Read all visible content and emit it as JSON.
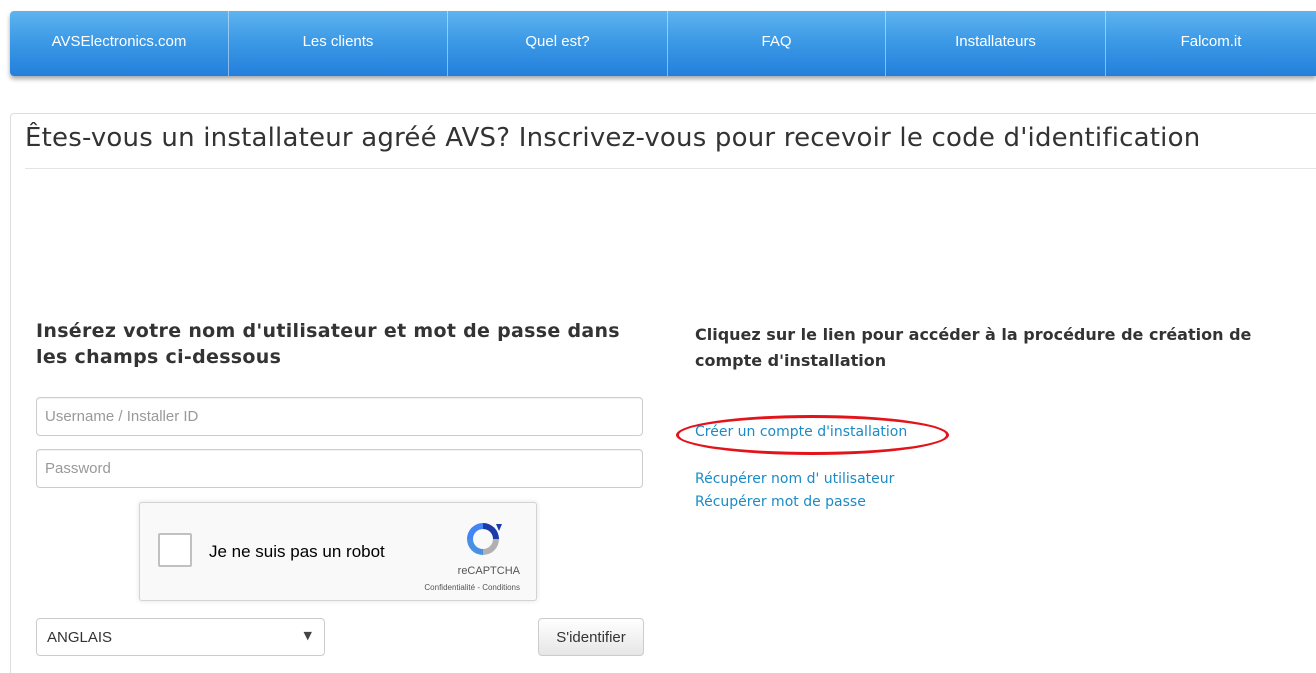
{
  "nav": {
    "items": [
      {
        "label": "AVSElectronics.com"
      },
      {
        "label": "Les clients"
      },
      {
        "label": "Quel est?"
      },
      {
        "label": "FAQ"
      },
      {
        "label": "Installateurs"
      },
      {
        "label": "Falcom.it"
      }
    ]
  },
  "page": {
    "title": "Êtes-vous un installateur agréé AVS? Inscrivez-vous pour recevoir le code d'identification"
  },
  "login": {
    "heading": "Insérez votre nom d'utilisateur et mot de passe dans les champs ci-dessous",
    "username_placeholder": "Username / Installer ID",
    "password_placeholder": "Password",
    "captcha": {
      "label": "Je ne suis pas un robot",
      "brand": "reCAPTCHA",
      "links": "Confidentialité - Conditions"
    },
    "language": {
      "selected": "ANGLAIS"
    },
    "submit_label": "S'identifier"
  },
  "account": {
    "heading": "Cliquez sur le lien pour accéder à la procédure de création de compte d'installation",
    "create_link": "Créer un compte d'installation",
    "recover_user_link": "Récupérer nom d' utilisateur",
    "recover_pass_link": "Récupérer mot de passe"
  },
  "colors": {
    "nav_top": "#5fb4f0",
    "nav_bottom": "#237fdb",
    "link": "#1a8bc6",
    "annotation_ellipse": "#e3131a"
  },
  "icons": {
    "captcha_logo": "recaptcha-logo-icon",
    "select_arrow": "chevron-down-icon"
  }
}
